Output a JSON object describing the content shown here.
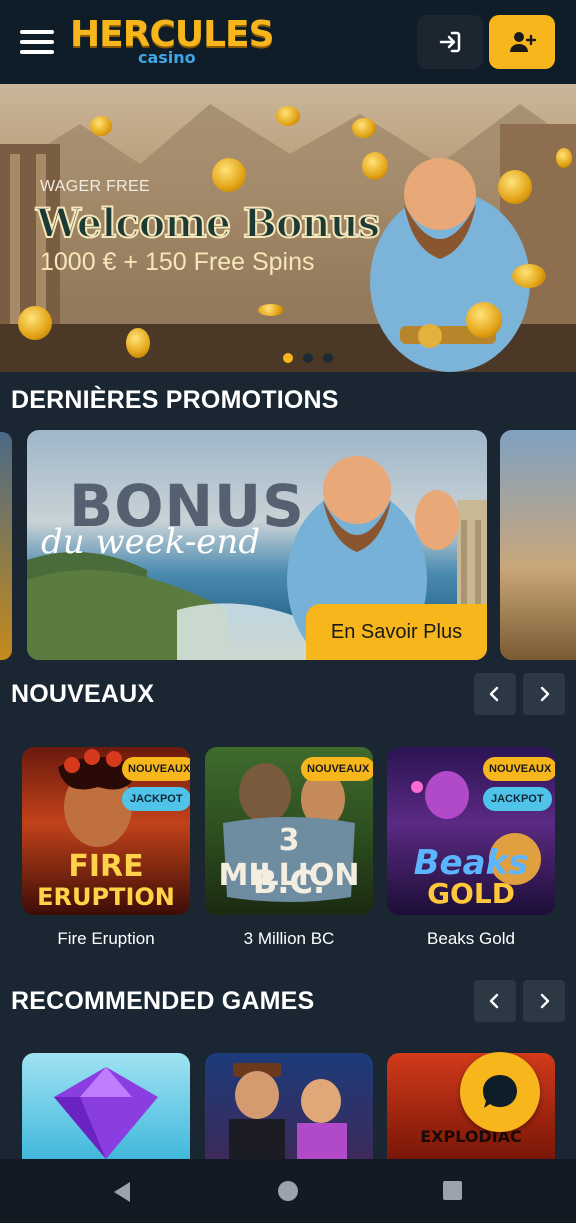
{
  "header": {
    "logo_main": "HERCULES",
    "logo_sub": "casino",
    "login_icon": "login-arrow-icon",
    "register_icon": "user-plus-icon"
  },
  "hero": {
    "eyebrow": "WAGER FREE",
    "title": "Welcome Bonus",
    "subtitle": "1000 € + 150 Free Spins",
    "active_slide": 1,
    "slide_count": 3
  },
  "promotions": {
    "title": "DERNIÈRES PROMOTIONS",
    "card": {
      "headline": "BONUS",
      "script": "du week-end",
      "button_label": "En Savoir Plus"
    }
  },
  "new_games": {
    "title": "NOUVEAUX",
    "items": [
      {
        "name": "Fire Eruption",
        "badge": "NOUVEAUX",
        "jackpot": "JACKPOT",
        "art_line1": "FIRE",
        "art_line2": "ERUPTION"
      },
      {
        "name": "3 Million BC",
        "badge": "NOUVEAUX",
        "art_line1": "3 MILLION",
        "art_line2": "B.C."
      },
      {
        "name": "Beaks Gold",
        "badge": "NOUVEAUX",
        "jackpot": "JACKPOT",
        "art_line1": "Beaks",
        "art_line2": "GOLD"
      }
    ]
  },
  "recommended": {
    "title": "RECOMMENDED GAMES",
    "items": [
      {
        "name": "diamond"
      },
      {
        "name": "detectives"
      },
      {
        "name": "Explodiac",
        "art_text": "EXPLODIAC"
      }
    ]
  },
  "colors": {
    "accent": "#f6b61c",
    "background": "#1a2733",
    "header": "#0f1d29",
    "jackpot": "#4fc4e8"
  }
}
